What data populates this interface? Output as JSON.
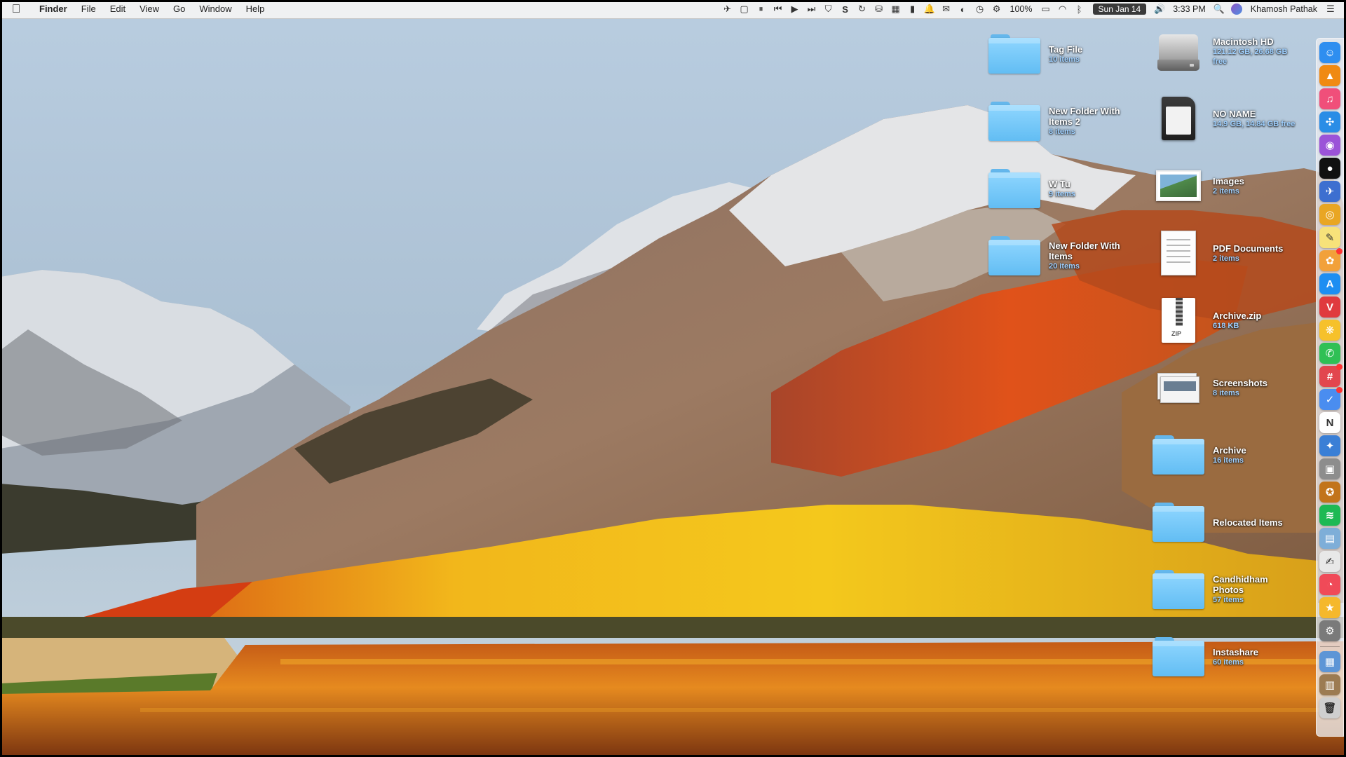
{
  "menubar": {
    "apple_icon": "apple-logo-icon",
    "app_name": "Finder",
    "menus": [
      "File",
      "Edit",
      "View",
      "Go",
      "Window",
      "Help"
    ],
    "status_icons": [
      "dropzone-icon",
      "screen-icon",
      "pause-icon",
      "prev-track-icon",
      "play-icon",
      "next-track-icon",
      "shield-icon",
      "s-icon",
      "sync-icon",
      "disk-icon",
      "cpu-icon",
      "bars-icon",
      "bell-icon",
      "notification-icon",
      "toggle-icon",
      "clock-icon",
      "gear-icon"
    ],
    "battery_label": "100%",
    "date": "Sun Jan 14",
    "volume_icon": "volume-icon",
    "time": "3:33 PM",
    "search_icon": "spotlight-search-icon",
    "user_name": "Khamosh Pathak",
    "menu_icon": "menu-list-icon"
  },
  "desktop": {
    "col1": [
      {
        "name": "Tag File",
        "info": "10 items",
        "icon": "folder-icon"
      },
      {
        "name": "New Folder With Items 2",
        "info": "8 items",
        "icon": "folder-icon"
      },
      {
        "name": "W Tu",
        "info": "9 items",
        "icon": "folder-icon"
      },
      {
        "name": "New Folder With Items",
        "info": "20 items",
        "icon": "folder-icon"
      }
    ],
    "col2": [
      {
        "name": "Macintosh HD",
        "info": "121.12 GB, 26.68 GB free",
        "icon": "hard-drive-icon"
      },
      {
        "name": "NO NAME",
        "info": "14.9 GB, 14.84 GB free",
        "icon": "sd-card-icon"
      },
      {
        "name": "Images",
        "info": "2 items",
        "icon": "picture-stack-icon"
      },
      {
        "name": "PDF Documents",
        "info": "2 items",
        "icon": "pdf-document-icon"
      },
      {
        "name": "Archive.zip",
        "info": "618 KB",
        "icon": "zip-archive-icon"
      },
      {
        "name": "Screenshots",
        "info": "8 items",
        "icon": "screenshot-stack-icon"
      },
      {
        "name": "Archive",
        "info": "16 items",
        "icon": "folder-icon"
      },
      {
        "name": "Relocated Items",
        "info": "",
        "icon": "folder-icon"
      },
      {
        "name": "Candhidham Photos",
        "info": "57 items",
        "icon": "folder-icon"
      },
      {
        "name": "Instashare",
        "info": "60 items",
        "icon": "folder-icon"
      }
    ]
  },
  "dock": {
    "items": [
      {
        "icon": "finder-icon",
        "color": "#2e8ef0",
        "glyph": "☺"
      },
      {
        "icon": "vlc-icon",
        "color": "#f08a12",
        "glyph": "▲"
      },
      {
        "icon": "itunes-icon",
        "color": "#f04f7a",
        "glyph": "♫"
      },
      {
        "icon": "safari-icon",
        "color": "#2a8de6",
        "glyph": "✣"
      },
      {
        "icon": "podcasts-icon",
        "color": "#9b53d8",
        "glyph": "◉"
      },
      {
        "icon": "music-player-icon",
        "color": "#111111",
        "glyph": "●"
      },
      {
        "icon": "airmail-icon",
        "color": "#3d6fd0",
        "glyph": "✈"
      },
      {
        "icon": "chrome-icon",
        "color": "#e9a623",
        "glyph": "◎"
      },
      {
        "icon": "notes-icon",
        "color": "#f7e27a",
        "glyph": "✎"
      },
      {
        "icon": "photos-icon",
        "color": "#f2a13a",
        "glyph": "✿"
      },
      {
        "icon": "app-store-icon",
        "color": "#1d8ef2",
        "glyph": "A"
      },
      {
        "icon": "vivaldi-icon",
        "color": "#e03a3e",
        "glyph": "V"
      },
      {
        "icon": "tes-icon",
        "color": "#f6c12b",
        "glyph": "❋"
      },
      {
        "icon": "whatsapp-icon",
        "color": "#2fc055",
        "glyph": "✆"
      },
      {
        "icon": "slack-icon",
        "color": "#e2464e",
        "glyph": "#"
      },
      {
        "icon": "things-icon",
        "color": "#4a8df0",
        "glyph": "✓"
      },
      {
        "icon": "notion-icon",
        "color": "#ffffff",
        "glyph": "N"
      },
      {
        "icon": "tweetbot-icon",
        "color": "#3a7fd6",
        "glyph": "✦"
      },
      {
        "icon": "box-icon",
        "color": "#8d8d8d",
        "glyph": "▣"
      },
      {
        "icon": "rocket-typist-icon",
        "color": "#c2741b",
        "glyph": "✪"
      },
      {
        "icon": "spotify-icon",
        "color": "#1db954",
        "glyph": "≋"
      },
      {
        "icon": "preview-icon",
        "color": "#7eaed8",
        "glyph": "▤"
      },
      {
        "icon": "textedit-icon",
        "color": "#e8e8e8",
        "glyph": "✍"
      },
      {
        "icon": "scrobbles-icon",
        "color": "#f04a58",
        "glyph": "◔"
      },
      {
        "icon": "bear-icon",
        "color": "#f5b82c",
        "glyph": "★"
      },
      {
        "icon": "system-preferences-icon",
        "color": "#7a7a7a",
        "glyph": "⚙"
      },
      {
        "icon": "downloads-stack-icon",
        "color": "#5d95d6",
        "glyph": "▦"
      },
      {
        "icon": "documents-stack-icon",
        "color": "#9c7b52",
        "glyph": "▥"
      },
      {
        "icon": "trash-icon",
        "color": "#cfcfcf",
        "glyph": "🗑"
      }
    ]
  },
  "colors": {
    "folder": "#62bdf3",
    "menubar": "#f3f3f3",
    "date_badge": "#3a3a3a"
  }
}
